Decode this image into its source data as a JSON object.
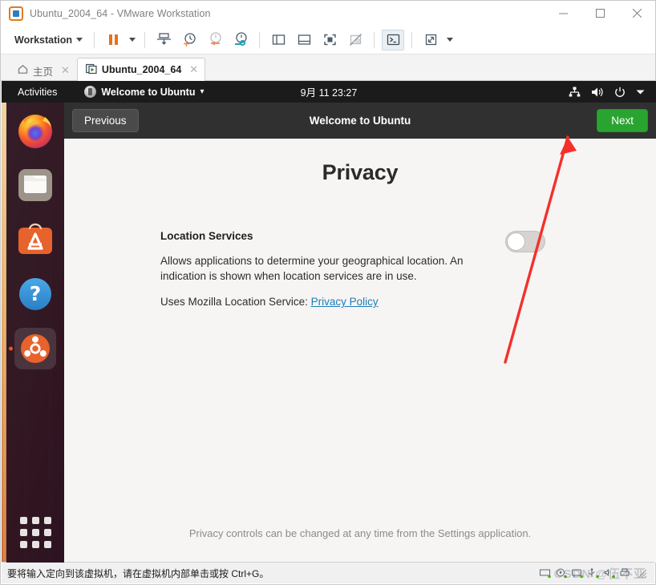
{
  "window": {
    "title": "Ubuntu_2004_64 - VMware Workstation",
    "app_icon": "vmware-icon",
    "controls": [
      {
        "name": "minimize-button",
        "glyph": "—"
      },
      {
        "name": "maximize-button",
        "glyph": "□"
      },
      {
        "name": "close-button",
        "glyph": "✕"
      }
    ]
  },
  "toolbar": {
    "menu_label": "Workstation",
    "buttons": [
      {
        "name": "pause-button",
        "icon": "pause-icon"
      },
      {
        "name": "pause-dropdown",
        "icon": "caret-down-icon"
      },
      {
        "name": "manage-snapshot-button",
        "icon": "snapshot-save-icon"
      },
      {
        "name": "take-snapshot-button",
        "icon": "snapshot-add-icon"
      },
      {
        "name": "revert-snapshot-button",
        "icon": "snapshot-revert-icon"
      },
      {
        "name": "snapshot-manager-button",
        "icon": "snapshot-manager-icon"
      },
      {
        "name": "show-library-button",
        "icon": "panel-left-icon"
      },
      {
        "name": "show-thumbnail-bar-button",
        "icon": "panel-bottom-icon"
      },
      {
        "name": "fullscreen-button",
        "icon": "fullscreen-icon"
      },
      {
        "name": "unity-mode-button",
        "icon": "unity-mode-icon"
      },
      {
        "name": "console-view-button",
        "icon": "console-prompt-icon"
      },
      {
        "name": "stretch-guest-button",
        "icon": "expand-arrows-icon"
      },
      {
        "name": "stretch-dropdown",
        "icon": "caret-down-icon"
      }
    ]
  },
  "tabs": [
    {
      "name": "tab-home",
      "label": "主页",
      "icon": "home-icon",
      "active": false,
      "close": "✕"
    },
    {
      "name": "tab-vm",
      "label": "Ubuntu_2004_64",
      "icon": "vm-play-icon",
      "active": true,
      "close": "✕"
    }
  ],
  "guest": {
    "panel": {
      "activities": "Activities",
      "app_name": "Welcome to Ubuntu",
      "app_caret": "▾",
      "clock": "9月 11  23:27",
      "tray": [
        {
          "name": "network-icon"
        },
        {
          "name": "volume-icon"
        },
        {
          "name": "power-icon"
        },
        {
          "name": "chevron-down-icon"
        }
      ]
    },
    "dock": [
      {
        "name": "dock-item-firefox",
        "label": "Firefox",
        "running": false
      },
      {
        "name": "dock-item-files",
        "label": "Files",
        "running": false
      },
      {
        "name": "dock-item-ubuntu-software",
        "label": "Ubuntu Software",
        "running": false
      },
      {
        "name": "dock-item-help",
        "label": "Help",
        "running": false
      },
      {
        "name": "dock-item-welcome-to-ubuntu",
        "label": "Welcome to Ubuntu",
        "running": true
      }
    ],
    "show_apps_label": "Show Applications"
  },
  "welcome": {
    "previous_label": "Previous",
    "header_title": "Welcome to Ubuntu",
    "next_label": "Next",
    "page_title": "Privacy",
    "setting": {
      "name": "Location Services",
      "description": "Allows applications to determine your geographical location. An indication is shown when location services are in use.",
      "sub_prefix": "Uses Mozilla Location Service: ",
      "link_label": "Privacy Policy",
      "toggle_state": "off"
    },
    "footer": "Privacy controls can be changed at any time from the Settings application."
  },
  "statusbar": {
    "message": "要将输入定向到该虚拟机，请在虚拟机内部单击或按 Ctrl+G。",
    "devices": [
      {
        "name": "device-hard-disk"
      },
      {
        "name": "device-cd-dvd"
      },
      {
        "name": "device-network-adapter"
      },
      {
        "name": "device-usb"
      },
      {
        "name": "device-sound-card"
      },
      {
        "name": "device-printer"
      }
    ],
    "watermark": "CSDN @伍不亚"
  },
  "annotation": {
    "arrow_color": "#f5302c",
    "points_to": "next-button"
  },
  "colors": {
    "next_green": "#2aa431",
    "ubuntu_orange": "#e95420",
    "panel_dark": "#1b1b1b",
    "header_dark": "#303030",
    "link_blue": "#1c7eb8"
  }
}
